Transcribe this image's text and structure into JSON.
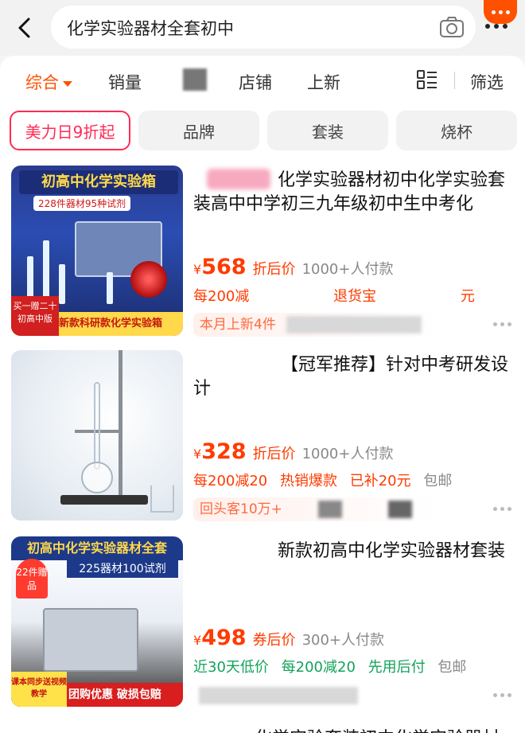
{
  "header": {
    "search_query": "化学实验器材全套初中",
    "back_icon": "chevron-left-icon",
    "camera_icon": "camera-icon"
  },
  "sort_bar": {
    "items": [
      "综合",
      "销量",
      "店铺",
      "上新"
    ],
    "filter_label": "筛选"
  },
  "chips": [
    "美力日9折起",
    "品牌",
    "套装",
    "烧杯"
  ],
  "products": [
    {
      "title": "化学实验器材初中化学实验套装高中中学初三九年级初中生中考化",
      "price_symbol": "¥",
      "price": "568",
      "price_note": "折后价",
      "buyers": "1000+人付款",
      "promos": [
        "每200减",
        "退货宝",
        "元"
      ],
      "tag": "本月上新4件",
      "image": {
        "title": "初高中化学实验箱",
        "subtitle": "228件器材95种试剂",
        "badge": "买一赠二十",
        "badge2": "初高中版",
        "bottom": "新款科研款化学实验箱"
      }
    },
    {
      "title": "【冠军推荐】针对中考研发设计",
      "price_symbol": "¥",
      "price": "328",
      "price_note": "折后价",
      "buyers": "1000+人付款",
      "promos": [
        "每200减20",
        "热销爆款",
        "已补20元",
        "包邮"
      ],
      "tag": "回头客10万+"
    },
    {
      "title": "新款初高中化学实验器材套装",
      "price_symbol": "¥",
      "price": "498",
      "price_note": "券后价",
      "buyers": "300+人付款",
      "promos": [
        "近30天低价",
        "每200减20",
        "先用后付",
        "包邮"
      ],
      "image": {
        "title": "初高中化学实验器材全套",
        "subtitle": "225器材100试剂",
        "badge": "22件赠品",
        "badge2": "课本同步送视频教学",
        "bottom": "团购优惠 破损包赔"
      }
    }
  ],
  "next_product_peek": "化学实验套装初中化学实验器材"
}
